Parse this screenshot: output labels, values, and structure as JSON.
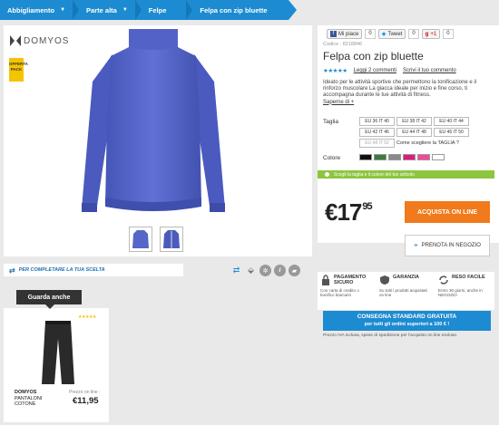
{
  "breadcrumb": [
    {
      "label": "Abbigliamento"
    },
    {
      "label": "Parte alta"
    },
    {
      "label": "Felpe"
    },
    {
      "label": "Felpa con zip bluette"
    }
  ],
  "brand": {
    "logo_text": "DOMYOS",
    "badge_text": "OFFERTA PACK"
  },
  "social": {
    "fb_label": "Mi piace",
    "fb_count": "0",
    "tw_label": "Tweet",
    "tw_count": "0",
    "gp_label": "+1",
    "gp_count": "0"
  },
  "product": {
    "code": "Codice : 8218846",
    "title": "Felpa con zip bluette",
    "reviews_link": "Leggi 2 commenti",
    "write_review_link": "Scrivi il tuo commento",
    "description": "Ideato per le attività sportive che permettono la tonificazione e il rinforzo muscolare La giacca ideale per inizio e fine corso, ti accompagna durante le tue attività di fitness.",
    "more_link": "Saperne di +",
    "size_label": "Taglia",
    "sizes": [
      {
        "label": "EU 36 IT 40",
        "available": true
      },
      {
        "label": "EU 38 IT 42",
        "available": true
      },
      {
        "label": "EU 40 IT 44",
        "available": true
      },
      {
        "label": "EU 42 IT 46",
        "available": true
      },
      {
        "label": "EU 44 IT 48",
        "available": true
      },
      {
        "label": "EU 46 IT 50",
        "available": true
      },
      {
        "label": "EU 48 IT 52",
        "available": false
      }
    ],
    "size_guide_link": "Come scegliere la TAGLIA ?",
    "color_label": "Colore",
    "colors": [
      "#111111",
      "#3f7a3a",
      "#8a8a8a",
      "#e0197a",
      "#f5489a",
      "#ffffff"
    ],
    "select_hint": "Scegli la taglia e il colore del tuo articolo",
    "price_main": "€17",
    "price_cents": "95",
    "buy_button": "ACQUISTA ON LINE",
    "store_button": "PRENOTA IN NEGOZIO"
  },
  "complete_bar": {
    "label": "PER COMPLETARE LA TUA SCELTA"
  },
  "guarantees": [
    {
      "title": "PAGAMENTO SICURO",
      "text": "Con carta di credito o bonifico bancario"
    },
    {
      "title": "GARANZIA",
      "text": "Su tutti i prodotti acquistati on line"
    },
    {
      "title": "RESO FACILE",
      "text": "Entro 30 giorni, anche in NEGOZIO"
    }
  ],
  "shipping_banner": {
    "line1": "CONSEGNA STANDARD GRATUITA",
    "line2": "per tutti gli ordini superiori a 100 € !"
  },
  "fine_print": "Prezzo IVA inclusa, spese di spedizione per l'acquisto on line escluse.",
  "see_also": {
    "tab_label": "Guarda anche",
    "item": {
      "brand": "DOMYOS",
      "name_line1": "PANTALONI",
      "name_line2": "COTONE",
      "price_label": "Prezzo on line :",
      "price": "€11,95",
      "rating_stars": 5
    }
  },
  "accent_colors": {
    "blue": "#1d8bd1",
    "orange": "#f07a1c",
    "green": "#8cc63f",
    "jacket": "#5566c8"
  }
}
